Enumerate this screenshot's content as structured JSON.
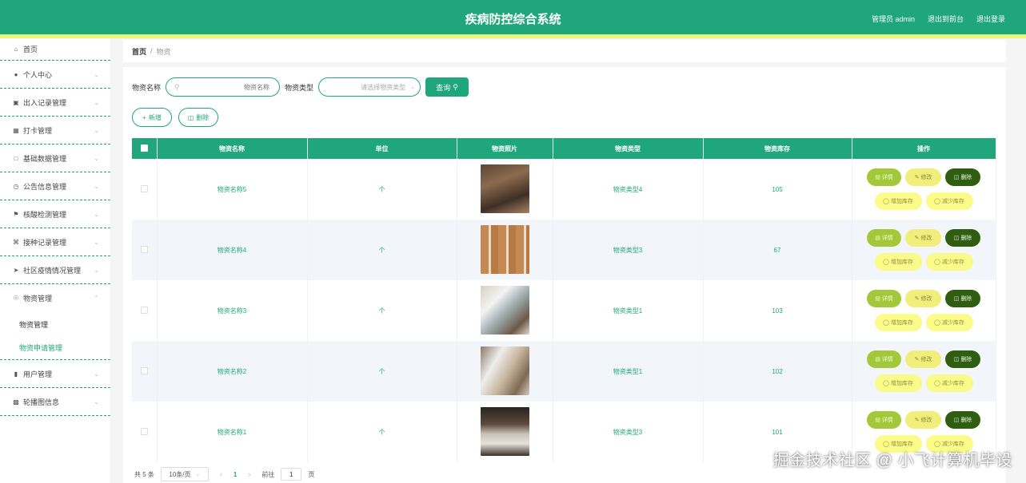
{
  "header": {
    "title": "疾病防控综合系统",
    "links": [
      "管理员 admin",
      "退出到前台",
      "退出登录"
    ]
  },
  "sidebar": {
    "items": [
      {
        "label": "首页",
        "icon": "home-icon"
      },
      {
        "label": "个人中心",
        "icon": "user-icon"
      },
      {
        "label": "出入记录管理",
        "icon": "briefcase-icon"
      },
      {
        "label": "打卡管理",
        "icon": "grid-icon"
      },
      {
        "label": "基础数据管理",
        "icon": "message-icon"
      },
      {
        "label": "公告信息管理",
        "icon": "clock-icon"
      },
      {
        "label": "核酸检测管理",
        "icon": "flag-icon"
      },
      {
        "label": "接种记录管理",
        "icon": "crop-icon"
      },
      {
        "label": "社区疫情情况管理",
        "icon": "send-icon"
      },
      {
        "label": "物资管理",
        "icon": "dashboard-icon"
      },
      {
        "label": "用户管理",
        "icon": "chart-icon"
      },
      {
        "label": "轮播图信息",
        "icon": "chat-icon"
      }
    ],
    "subitems": [
      "物资管理",
      "物资申请管理"
    ]
  },
  "breadcrumb": {
    "home": "首页",
    "sep": "/",
    "current": "物资"
  },
  "search": {
    "name_label": "物资名称",
    "name_placeholder": "物资名称",
    "type_label": "物资类型",
    "type_placeholder": "请选择物资类型",
    "button": "查询"
  },
  "actions": {
    "add": "新增",
    "delete": "删除"
  },
  "table": {
    "headers": [
      "物资名称",
      "单位",
      "物资照片",
      "物资类型",
      "物资库存",
      "操作"
    ],
    "rows": [
      {
        "name": "物资名称5",
        "unit": "个",
        "type": "物资类型4",
        "stock": "105"
      },
      {
        "name": "物资名称4",
        "unit": "个",
        "type": "物资类型3",
        "stock": "67"
      },
      {
        "name": "物资名称3",
        "unit": "个",
        "type": "物资类型1",
        "stock": "103"
      },
      {
        "name": "物资名称2",
        "unit": "个",
        "type": "物资类型1",
        "stock": "102"
      },
      {
        "name": "物资名称1",
        "unit": "个",
        "type": "物资类型3",
        "stock": "101"
      }
    ],
    "ops": {
      "detail": "详情",
      "edit": "修改",
      "delete": "删除",
      "add_stock": "增加库存",
      "reduce_stock": "减少库存"
    }
  },
  "pagination": {
    "total": "共 5 条",
    "page_size": "10条/页",
    "current_page": "1",
    "goto_label": "前往",
    "goto_value": "1",
    "page_suffix": "页"
  },
  "watermark": "掘金技术社区 @ 小飞计算机毕设",
  "colors": {
    "primary": "#1fa67a",
    "stripe": "#e9f77a",
    "detail": "#a3c93b",
    "edit": "#f1ee7c",
    "delete": "#2f5e10",
    "stock": "#fbfb8a"
  }
}
